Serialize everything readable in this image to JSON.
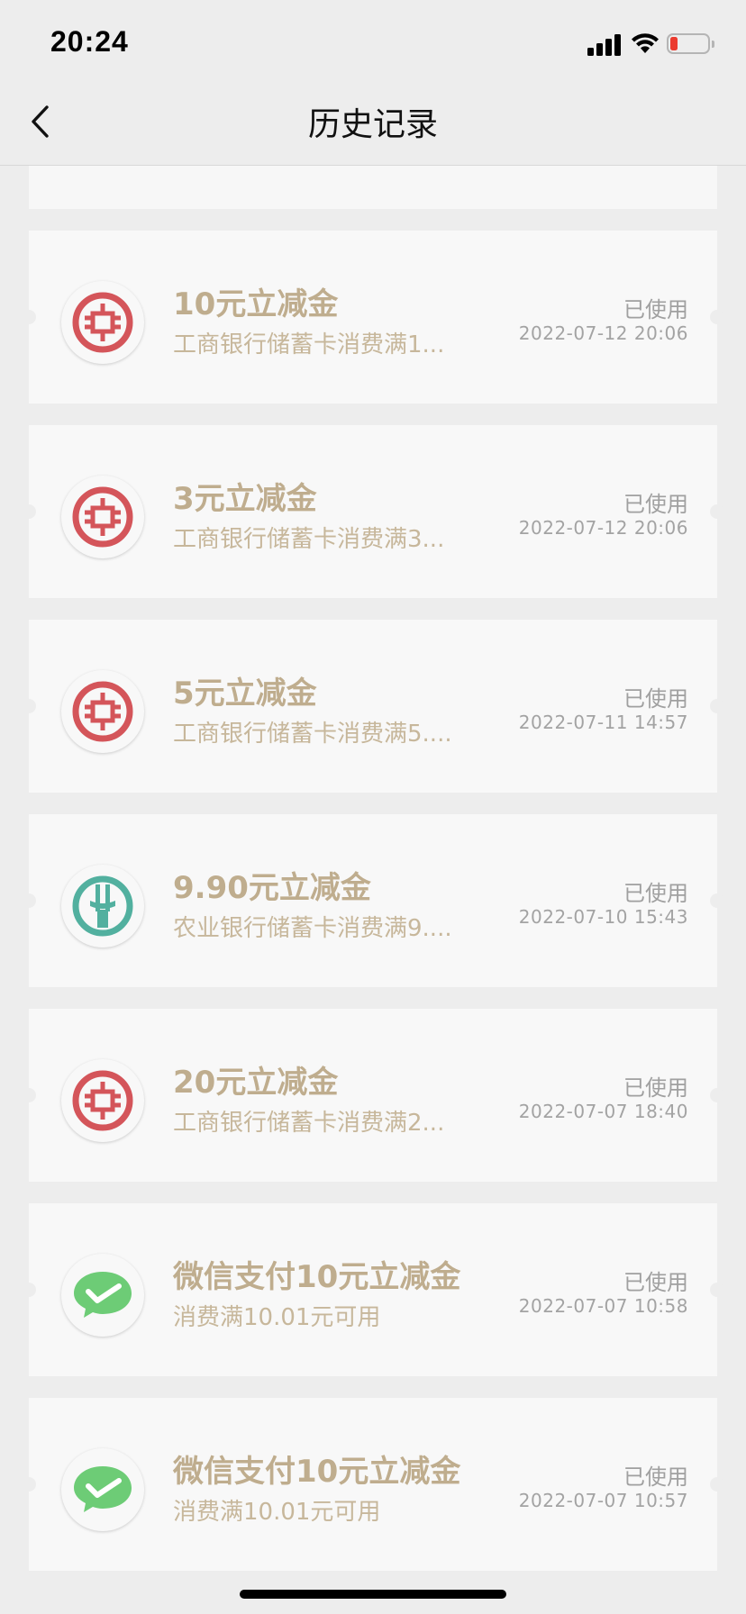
{
  "status_bar": {
    "time": "20:24",
    "battery_level": 0.1,
    "battery_color": "#eb3b2f"
  },
  "nav": {
    "title": "历史记录",
    "back_icon": "chevron-left-icon"
  },
  "colors": {
    "title": "#bfad8e",
    "subtitle": "#c7b79b",
    "status": "#a0a0a0",
    "icbc_red": "#d4555a",
    "abc_teal": "#52b09f",
    "wechat_green": "#6dcc76"
  },
  "vouchers": [
    {
      "logo": "icbc-logo",
      "title": "10元立减金",
      "subtitle": "工商银行储蓄卡消费满1...",
      "status": "已使用",
      "time": "2022-07-12 20:06"
    },
    {
      "logo": "icbc-logo",
      "title": "3元立减金",
      "subtitle": "工商银行储蓄卡消费满3...",
      "status": "已使用",
      "time": "2022-07-12 20:06"
    },
    {
      "logo": "icbc-logo",
      "title": "5元立减金",
      "subtitle": "工商银行储蓄卡消费满5....",
      "status": "已使用",
      "time": "2022-07-11 14:57"
    },
    {
      "logo": "abc-logo",
      "title": "9.90元立减金",
      "subtitle": "农业银行储蓄卡消费满9....",
      "status": "已使用",
      "time": "2022-07-10 15:43"
    },
    {
      "logo": "icbc-logo",
      "title": "20元立减金",
      "subtitle": "工商银行储蓄卡消费满2...",
      "status": "已使用",
      "time": "2022-07-07 18:40"
    },
    {
      "logo": "wechat-pay-logo",
      "title": "微信支付10元立减金",
      "subtitle": "消费满10.01元可用",
      "status": "已使用",
      "time": "2022-07-07 10:58"
    },
    {
      "logo": "wechat-pay-logo",
      "title": "微信支付10元立减金",
      "subtitle": "消费满10.01元可用",
      "status": "已使用",
      "time": "2022-07-07 10:57"
    }
  ]
}
